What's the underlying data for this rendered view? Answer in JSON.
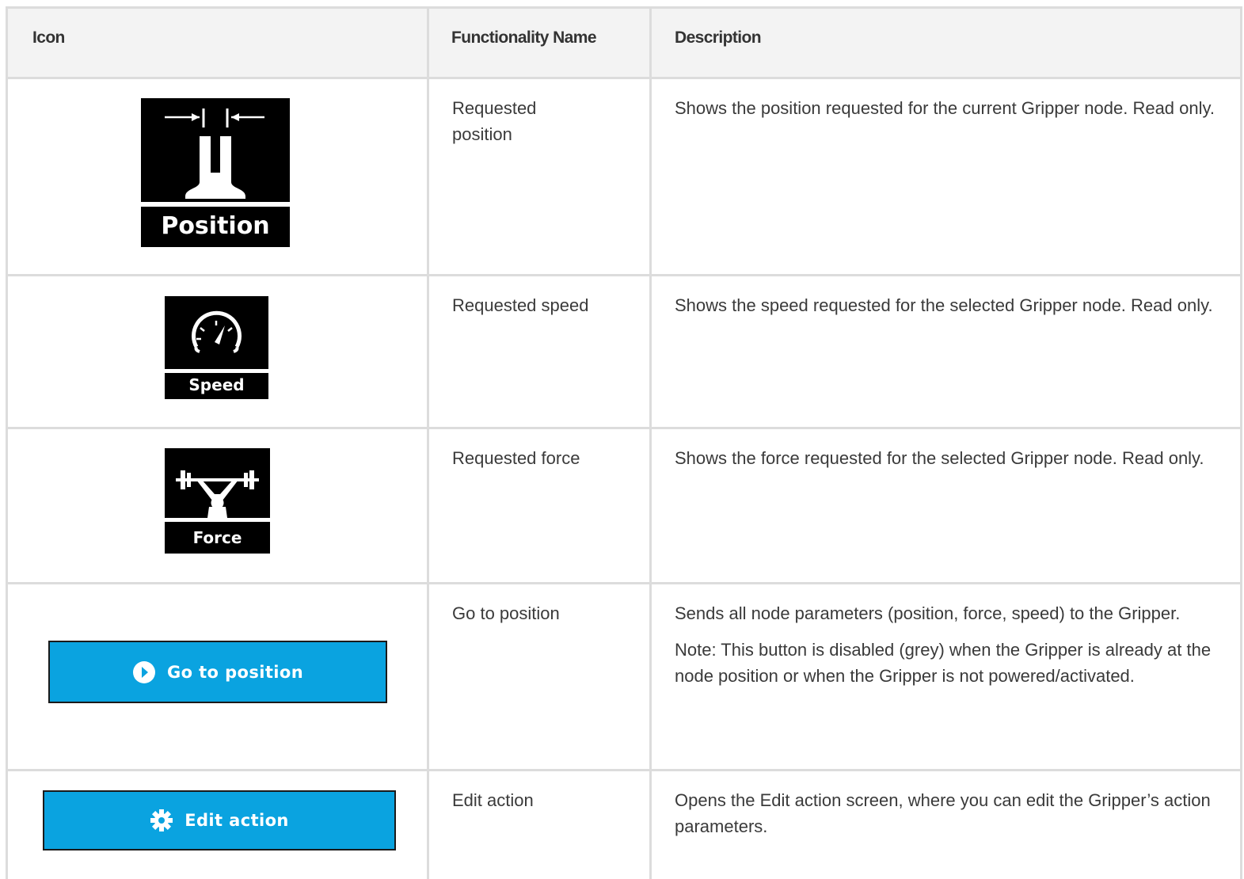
{
  "header": {
    "icon": "Icon",
    "functionality": "Functionality Name",
    "description": "Description"
  },
  "rows": [
    {
      "icon_name": "gripper-position-icon",
      "icon_label": "Position",
      "name": "Requested\nposition",
      "description": "Shows the position requested for the current Gripper node. Read only."
    },
    {
      "icon_name": "speedometer-icon",
      "icon_label": "Speed",
      "name": "Requested speed",
      "description": "Shows the speed requested for the selected Gripper node. Read only."
    },
    {
      "icon_name": "weightlifter-icon",
      "icon_label": "Force",
      "name": "Requested force",
      "description": "Shows the force requested for the selected Gripper node. Read only."
    },
    {
      "icon_name": "play-circle-icon",
      "button_label": "Go to position",
      "name": "Go to position",
      "description": "Sends all node parameters (position, force, speed) to the Gripper.",
      "note": "Note: This button is disabled (grey) when the Gripper is already at the node position or when the Gripper is not powered/activated."
    },
    {
      "icon_name": "gear-icon",
      "button_label": "Edit action",
      "name": "Edit action",
      "description": "Opens the Edit action screen, where you can edit the Gripper’s action parameters."
    }
  ],
  "colors": {
    "button_blue": "#0aa3e0",
    "header_bg": "#f3f3f3",
    "grid_line": "#dcdcdc",
    "icon_bg": "#000000"
  }
}
